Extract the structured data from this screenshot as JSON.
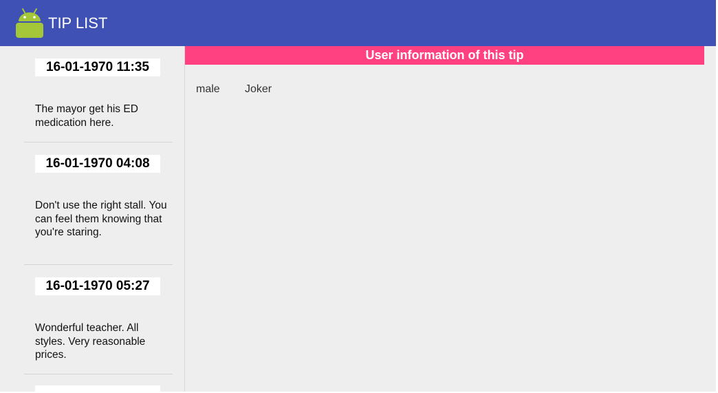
{
  "app": {
    "title": "TIP LIST",
    "icon": "android-icon",
    "colors": {
      "app_bar": "#3f51b5",
      "accent": "#ff4081",
      "background": "#eeeeee",
      "date_chip": "#ffffff"
    }
  },
  "tips": [
    {
      "date": "16-01-1970 11:35",
      "text": "The mayor get his ED medication here."
    },
    {
      "date": "16-01-1970 04:08",
      "text": "Don't use the right stall. You can feel them knowing that you're staring."
    },
    {
      "date": "16-01-1970 05:27",
      "text": "Wonderful teacher. All styles. Very reasonable prices."
    }
  ],
  "detail": {
    "header": "User information of this tip",
    "user": {
      "gender": "male",
      "name": "Joker"
    }
  }
}
